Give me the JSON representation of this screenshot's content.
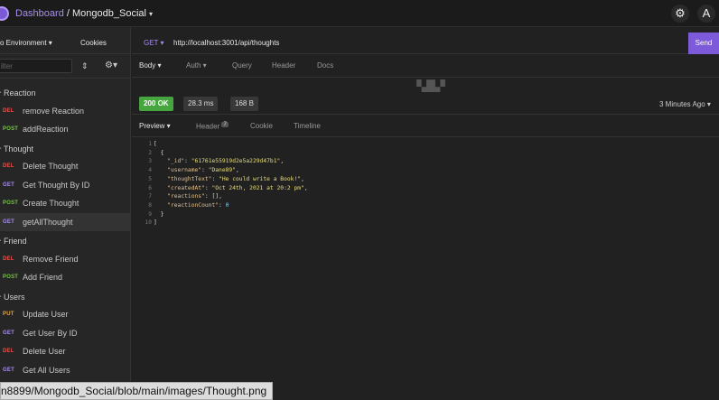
{
  "header": {
    "workspace": "Dashboard",
    "separator": " / ",
    "project": "Mongodb_Social",
    "caret": "▾",
    "settings_icon": "⚙",
    "account_icon": "A"
  },
  "sidebar": {
    "environment": "o Environment ▾",
    "cookies": "Cookies",
    "filter_placeholder": "ilter",
    "sort_icon": "⇕",
    "gear_icon": "⚙▾",
    "items": [
      {
        "type": "folder",
        "label": "Reaction"
      },
      {
        "type": "request",
        "method": "DEL",
        "label": "remove Reaction"
      },
      {
        "type": "request",
        "method": "POST",
        "label": "addReaction"
      },
      {
        "type": "folder",
        "label": "Thought"
      },
      {
        "type": "request",
        "method": "DEL",
        "label": "Delete Thought"
      },
      {
        "type": "request",
        "method": "GET",
        "label": "Get Thought By ID"
      },
      {
        "type": "request",
        "method": "POST",
        "label": "Create Thought"
      },
      {
        "type": "request",
        "method": "GET",
        "label": "getAllThought",
        "active": true
      },
      {
        "type": "folder",
        "label": "Friend"
      },
      {
        "type": "request",
        "method": "DEL",
        "label": "Remove Friend"
      },
      {
        "type": "request",
        "method": "POST",
        "label": "Add Friend"
      },
      {
        "type": "folder",
        "label": "Users"
      },
      {
        "type": "request",
        "method": "PUT",
        "label": "Update User"
      },
      {
        "type": "request",
        "method": "GET",
        "label": "Get User By ID"
      },
      {
        "type": "request",
        "method": "DEL",
        "label": "Delete User"
      },
      {
        "type": "request",
        "method": "GET",
        "label": "Get All Users"
      }
    ]
  },
  "request": {
    "method": "GET ▾",
    "url": "http://localhost:3001/api/thoughts",
    "send_label": "Send",
    "tabs": [
      "Body ▾",
      "Auth ▾",
      "Query",
      "Header",
      "Docs"
    ]
  },
  "response": {
    "status": "200 OK",
    "time": "28.3 ms",
    "size": "168 B",
    "ago": "3 Minutes Ago ▾",
    "tabs": {
      "preview": "Preview ▾",
      "header": "Header",
      "header_count": "7",
      "cookie": "Cookie",
      "timeline": "Timeline"
    },
    "lines": [
      {
        "n": "1",
        "text": "["
      },
      {
        "n": "2",
        "text": "  {"
      },
      {
        "n": "3",
        "key": "\"_id\"",
        "val": "\"61761e55919d2e5a229d47b1\"",
        "kind": "s"
      },
      {
        "n": "4",
        "key": "\"username\"",
        "val": "\"Dane89\"",
        "kind": "s"
      },
      {
        "n": "5",
        "key": "\"thoughtText\"",
        "val": "\"He could write a Book!\"",
        "kind": "s"
      },
      {
        "n": "6",
        "key": "\"createdAt\"",
        "val": "\"Oct 24th, 2021 at 20:2 pm\"",
        "kind": "s"
      },
      {
        "n": "7",
        "key": "\"reactions\"",
        "val": "[]",
        "kind": "p"
      },
      {
        "n": "8",
        "key": "\"reactionCount\"",
        "val": "0",
        "kind": "n"
      },
      {
        "n": "9",
        "text": "  }"
      },
      {
        "n": "10",
        "text": "]"
      }
    ]
  },
  "tooltip": "n8899/Mongodb_Social/blob/main/images/Thought.png"
}
